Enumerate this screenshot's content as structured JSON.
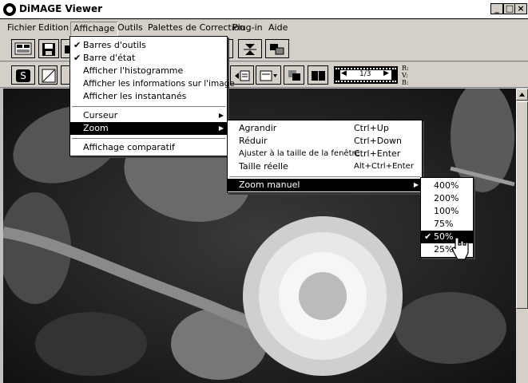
{
  "window": {
    "title": "DiMAGE Viewer",
    "controls": [
      "_",
      "□",
      "×"
    ]
  },
  "menubar": [
    "Fichier",
    "Edition",
    "Affichage",
    "Outils",
    "Palettes de Correction",
    "Plug-in",
    "Aide"
  ],
  "toolbar": {
    "frame_counter": "1/3",
    "rvb_labels": [
      "R:",
      "V:",
      "B:"
    ]
  },
  "affichage_menu": {
    "items": [
      {
        "label": "Barres d'outils",
        "checked": true
      },
      {
        "label": "Barre d'état",
        "checked": true
      },
      {
        "label": "Afficher l'histogramme"
      },
      {
        "label": "Afficher les informations sur l'image"
      },
      {
        "label": "Afficher les instantanés"
      },
      {
        "label": "Curseur",
        "submenu": true
      },
      {
        "label": "Zoom",
        "submenu": true,
        "selected": true
      },
      {
        "label": "Affichage comparatif"
      }
    ]
  },
  "zoom_menu": {
    "items": [
      {
        "label": "Agrandir",
        "shortcut": "Ctrl+Up"
      },
      {
        "label": "Réduir",
        "shortcut": "Ctrl+Down"
      },
      {
        "label": "Ajuster à la taille de la fenêtre",
        "shortcut": "Ctrl+Enter"
      },
      {
        "label": "Taille réelle",
        "shortcut": "Alt+Ctrl+Enter"
      },
      {
        "label": "Zoom manuel",
        "submenu": true,
        "selected": true
      }
    ]
  },
  "zoom_manuel_menu": {
    "items": [
      {
        "label": "400%"
      },
      {
        "label": "200%"
      },
      {
        "label": "100%"
      },
      {
        "label": "75%"
      },
      {
        "label": "50%",
        "checked": true,
        "selected": true
      },
      {
        "label": "25%"
      }
    ]
  }
}
